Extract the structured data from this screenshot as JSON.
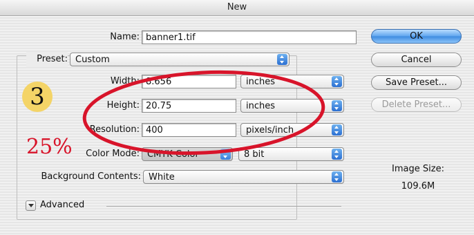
{
  "window": {
    "title": "New"
  },
  "form": {
    "name": {
      "label": "Name:",
      "value": "banner1.tif"
    },
    "preset": {
      "label": "Preset:",
      "value": "Custom"
    },
    "width": {
      "label": "Width:",
      "value": "8.656",
      "unit": "inches"
    },
    "height": {
      "label": "Height:",
      "value": "20.75",
      "unit": "inches"
    },
    "resolution": {
      "label": "Resolution:",
      "value": "400",
      "unit": "pixels/inch"
    },
    "color_mode": {
      "label": "Color Mode:",
      "value": "CMYK Color",
      "depth": "8 bit"
    },
    "background": {
      "label": "Background Contents:",
      "value": "White"
    },
    "advanced_label": "Advanced"
  },
  "buttons": {
    "ok": "OK",
    "cancel": "Cancel",
    "save_preset": "Save Preset...",
    "delete_preset": "Delete Preset..."
  },
  "image_size": {
    "label": "Image Size:",
    "value": "109.6M"
  },
  "annotations": {
    "step_number": "3",
    "zoom": "25%",
    "badge_color": "#f4d467",
    "highlight_color": "#d8142a"
  }
}
